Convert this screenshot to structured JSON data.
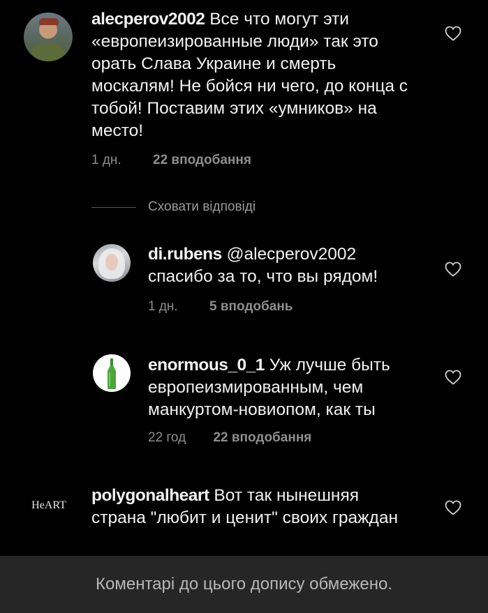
{
  "comments": [
    {
      "username": "alecperov2002",
      "text": " Все что могут эти «европеизированные люди» так это орать Слава Украине и смерть москалям! Не бойся ни чего, до конца с тобой! Поставим этих «умников» на место!",
      "time": "1 дн.",
      "likes": "22 вподобання",
      "avatar_icon": "profile-photo-soldier"
    },
    {
      "username": "di.rubens",
      "mention": " @alecperov2002",
      "text": "спасибо за то, что вы рядом!",
      "time": "1 дн.",
      "likes": "5 вподобань",
      "avatar_icon": "profile-photo-woman"
    },
    {
      "username": "enormous_0_1",
      "text": " Уж лучше быть европеизмированным, чем манкуртом-новиопом, как ты",
      "time": "22 год",
      "likes": "22 вподобання",
      "avatar_icon": "profile-photo-bottle"
    },
    {
      "username": "polygonalheart",
      "text": " Вот так нынешняя страна \"любит и ценит\" своих граждан",
      "avatar_text": "HeART"
    }
  ],
  "hide_replies_label": "Сховати відповіді",
  "footer_text": "Коментарі до цього допису обмежено.",
  "colors": {
    "background": "#000000",
    "text": "#f2f2f2",
    "secondary_text": "#8e8e8e",
    "footer_bg": "#262626"
  },
  "icons": {
    "like": "heart-outline-icon"
  }
}
